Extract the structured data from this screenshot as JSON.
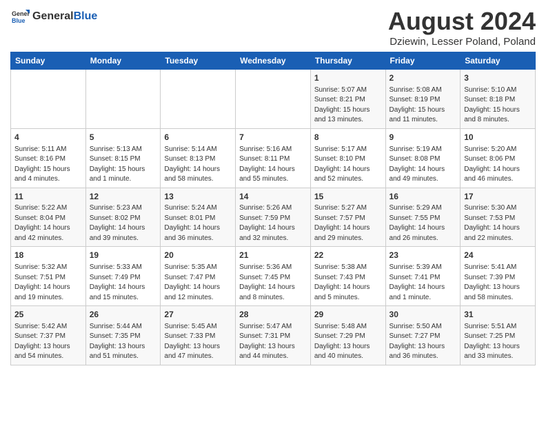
{
  "header": {
    "logo_general": "General",
    "logo_blue": "Blue",
    "month_title": "August 2024",
    "location": "Dziewin, Lesser Poland, Poland"
  },
  "days_of_week": [
    "Sunday",
    "Monday",
    "Tuesday",
    "Wednesday",
    "Thursday",
    "Friday",
    "Saturday"
  ],
  "weeks": [
    [
      {
        "day": "",
        "info": ""
      },
      {
        "day": "",
        "info": ""
      },
      {
        "day": "",
        "info": ""
      },
      {
        "day": "",
        "info": ""
      },
      {
        "day": "1",
        "info": "Sunrise: 5:07 AM\nSunset: 8:21 PM\nDaylight: 15 hours\nand 13 minutes."
      },
      {
        "day": "2",
        "info": "Sunrise: 5:08 AM\nSunset: 8:19 PM\nDaylight: 15 hours\nand 11 minutes."
      },
      {
        "day": "3",
        "info": "Sunrise: 5:10 AM\nSunset: 8:18 PM\nDaylight: 15 hours\nand 8 minutes."
      }
    ],
    [
      {
        "day": "4",
        "info": "Sunrise: 5:11 AM\nSunset: 8:16 PM\nDaylight: 15 hours\nand 4 minutes."
      },
      {
        "day": "5",
        "info": "Sunrise: 5:13 AM\nSunset: 8:15 PM\nDaylight: 15 hours\nand 1 minute."
      },
      {
        "day": "6",
        "info": "Sunrise: 5:14 AM\nSunset: 8:13 PM\nDaylight: 14 hours\nand 58 minutes."
      },
      {
        "day": "7",
        "info": "Sunrise: 5:16 AM\nSunset: 8:11 PM\nDaylight: 14 hours\nand 55 minutes."
      },
      {
        "day": "8",
        "info": "Sunrise: 5:17 AM\nSunset: 8:10 PM\nDaylight: 14 hours\nand 52 minutes."
      },
      {
        "day": "9",
        "info": "Sunrise: 5:19 AM\nSunset: 8:08 PM\nDaylight: 14 hours\nand 49 minutes."
      },
      {
        "day": "10",
        "info": "Sunrise: 5:20 AM\nSunset: 8:06 PM\nDaylight: 14 hours\nand 46 minutes."
      }
    ],
    [
      {
        "day": "11",
        "info": "Sunrise: 5:22 AM\nSunset: 8:04 PM\nDaylight: 14 hours\nand 42 minutes."
      },
      {
        "day": "12",
        "info": "Sunrise: 5:23 AM\nSunset: 8:02 PM\nDaylight: 14 hours\nand 39 minutes."
      },
      {
        "day": "13",
        "info": "Sunrise: 5:24 AM\nSunset: 8:01 PM\nDaylight: 14 hours\nand 36 minutes."
      },
      {
        "day": "14",
        "info": "Sunrise: 5:26 AM\nSunset: 7:59 PM\nDaylight: 14 hours\nand 32 minutes."
      },
      {
        "day": "15",
        "info": "Sunrise: 5:27 AM\nSunset: 7:57 PM\nDaylight: 14 hours\nand 29 minutes."
      },
      {
        "day": "16",
        "info": "Sunrise: 5:29 AM\nSunset: 7:55 PM\nDaylight: 14 hours\nand 26 minutes."
      },
      {
        "day": "17",
        "info": "Sunrise: 5:30 AM\nSunset: 7:53 PM\nDaylight: 14 hours\nand 22 minutes."
      }
    ],
    [
      {
        "day": "18",
        "info": "Sunrise: 5:32 AM\nSunset: 7:51 PM\nDaylight: 14 hours\nand 19 minutes."
      },
      {
        "day": "19",
        "info": "Sunrise: 5:33 AM\nSunset: 7:49 PM\nDaylight: 14 hours\nand 15 minutes."
      },
      {
        "day": "20",
        "info": "Sunrise: 5:35 AM\nSunset: 7:47 PM\nDaylight: 14 hours\nand 12 minutes."
      },
      {
        "day": "21",
        "info": "Sunrise: 5:36 AM\nSunset: 7:45 PM\nDaylight: 14 hours\nand 8 minutes."
      },
      {
        "day": "22",
        "info": "Sunrise: 5:38 AM\nSunset: 7:43 PM\nDaylight: 14 hours\nand 5 minutes."
      },
      {
        "day": "23",
        "info": "Sunrise: 5:39 AM\nSunset: 7:41 PM\nDaylight: 14 hours\nand 1 minute."
      },
      {
        "day": "24",
        "info": "Sunrise: 5:41 AM\nSunset: 7:39 PM\nDaylight: 13 hours\nand 58 minutes."
      }
    ],
    [
      {
        "day": "25",
        "info": "Sunrise: 5:42 AM\nSunset: 7:37 PM\nDaylight: 13 hours\nand 54 minutes."
      },
      {
        "day": "26",
        "info": "Sunrise: 5:44 AM\nSunset: 7:35 PM\nDaylight: 13 hours\nand 51 minutes."
      },
      {
        "day": "27",
        "info": "Sunrise: 5:45 AM\nSunset: 7:33 PM\nDaylight: 13 hours\nand 47 minutes."
      },
      {
        "day": "28",
        "info": "Sunrise: 5:47 AM\nSunset: 7:31 PM\nDaylight: 13 hours\nand 44 minutes."
      },
      {
        "day": "29",
        "info": "Sunrise: 5:48 AM\nSunset: 7:29 PM\nDaylight: 13 hours\nand 40 minutes."
      },
      {
        "day": "30",
        "info": "Sunrise: 5:50 AM\nSunset: 7:27 PM\nDaylight: 13 hours\nand 36 minutes."
      },
      {
        "day": "31",
        "info": "Sunrise: 5:51 AM\nSunset: 7:25 PM\nDaylight: 13 hours\nand 33 minutes."
      }
    ]
  ]
}
